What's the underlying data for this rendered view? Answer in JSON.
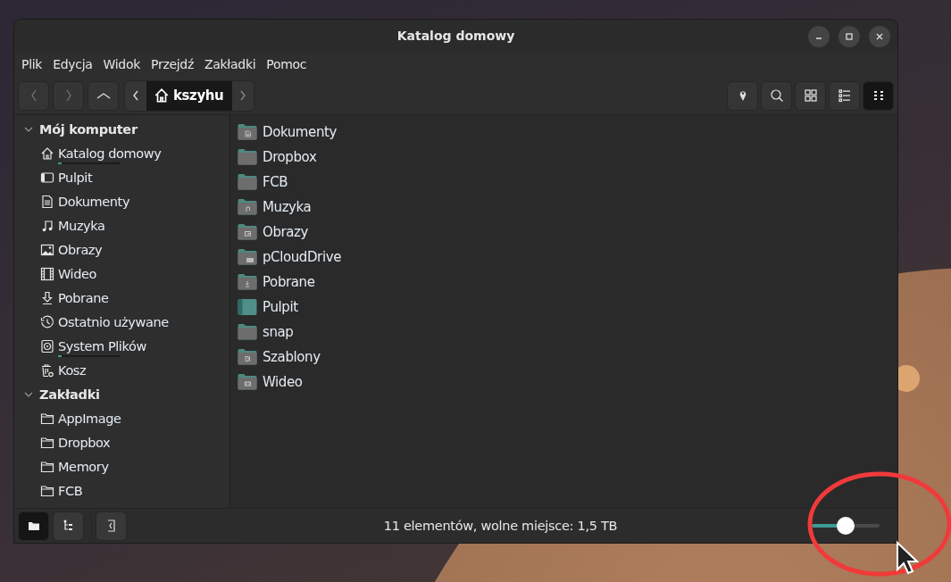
{
  "window": {
    "title": "Katalog domowy"
  },
  "menu": [
    "Plik",
    "Edycja",
    "Widok",
    "Przejdź",
    "Zakładki",
    "Pomoc"
  ],
  "toolbar": {
    "path": "kszyhu",
    "views": [
      {
        "kind": "location",
        "selected": false
      },
      {
        "kind": "search",
        "selected": false
      },
      {
        "kind": "icons",
        "selected": false
      },
      {
        "kind": "list",
        "selected": false
      },
      {
        "kind": "compact",
        "selected": true
      }
    ]
  },
  "sidebar": {
    "sections": [
      {
        "title": "Mój komputer",
        "expanded": true,
        "items": [
          {
            "kind": "home",
            "label": "Katalog domowy",
            "level": 0.05
          },
          {
            "kind": "desktop",
            "label": "Pulpit"
          },
          {
            "kind": "document",
            "label": "Dokumenty"
          },
          {
            "kind": "music",
            "label": "Muzyka"
          },
          {
            "kind": "image",
            "label": "Obrazy"
          },
          {
            "kind": "video",
            "label": "Wideo"
          },
          {
            "kind": "download",
            "label": "Pobrane"
          },
          {
            "kind": "recent",
            "label": "Ostatnio używane"
          },
          {
            "kind": "drive",
            "label": "System Plików",
            "level": 0.06
          },
          {
            "kind": "trash",
            "label": "Kosz"
          }
        ]
      },
      {
        "title": "Zakładki",
        "expanded": true,
        "items": [
          {
            "kind": "folder",
            "label": "AppImage"
          },
          {
            "kind": "folder",
            "label": "Dropbox"
          },
          {
            "kind": "folder",
            "label": "Memory"
          },
          {
            "kind": "folder",
            "label": "FCB"
          }
        ]
      }
    ]
  },
  "files": [
    {
      "kind": "document",
      "name": "Dokumenty"
    },
    {
      "kind": "plain",
      "name": "Dropbox"
    },
    {
      "kind": "plain",
      "name": "FCB"
    },
    {
      "kind": "music",
      "name": "Muzyka"
    },
    {
      "kind": "image",
      "name": "Obrazy"
    },
    {
      "kind": "cloud",
      "name": "pCloudDrive"
    },
    {
      "kind": "download",
      "name": "Pobrane"
    },
    {
      "kind": "desktop",
      "name": "Pulpit"
    },
    {
      "kind": "plain",
      "name": "snap"
    },
    {
      "kind": "template",
      "name": "Szablony"
    },
    {
      "kind": "video",
      "name": "Wideo"
    }
  ],
  "status_bar": {
    "panes": [
      {
        "kind": "places",
        "selected": true
      },
      {
        "kind": "tree",
        "selected": false
      }
    ],
    "text": "11 elementów, wolne miejsce: 1,5 TB",
    "zoom": {
      "level": 0.5
    }
  }
}
